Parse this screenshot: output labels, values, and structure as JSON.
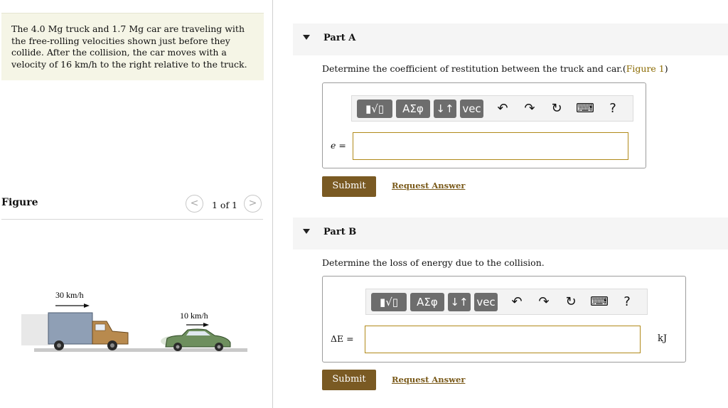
{
  "problem": {
    "lines": [
      "The 4.0 Mg truck and 1.7 Mg car are traveling with",
      "the free-rolling velocities shown just before they",
      "collide. After the collision, the car moves with a",
      "velocity of 16 km/h to the right relative to the truck."
    ]
  },
  "figure_panel": {
    "title": "Figure",
    "pager": "1 of 1",
    "prev": "<",
    "next": ">",
    "truck_speed": "30 km/h",
    "car_speed": "10 km/h"
  },
  "toolbar": {
    "templates": "▮√▯",
    "greek": "ΑΣφ",
    "arrows": "↓↑",
    "vec": "vec",
    "undo": "↶",
    "redo": "↷",
    "reset": "↻",
    "keyboard": "⌨",
    "help": "?"
  },
  "partA": {
    "title": "Part A",
    "question": "Determine the coefficient of restitution between the truck and car.(",
    "figure_link": "Figure 1",
    "question_end": ")",
    "var_label": "e =",
    "input_value": "",
    "submit": "Submit",
    "request": "Request Answer"
  },
  "partB": {
    "title": "Part B",
    "question": "Determine the loss of energy due to the collision.",
    "var_label": "ΔE =",
    "unit": "kJ",
    "input_value": "",
    "submit": "Submit",
    "request": "Request Answer"
  },
  "colors": {
    "accent": "#7a5a23",
    "problem_bg": "#f5f5e6",
    "header_bg": "#f5f5f5",
    "link": "#8a6a00"
  }
}
